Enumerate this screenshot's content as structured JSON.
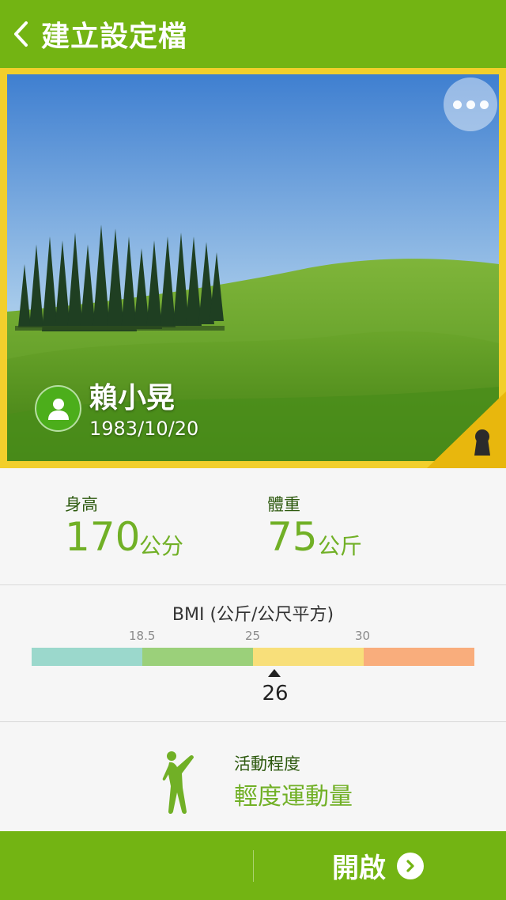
{
  "header": {
    "title": "建立設定檔"
  },
  "profile": {
    "name": "賴小晃",
    "birthdate": "1983/10/20"
  },
  "stats": {
    "height": {
      "label": "身高",
      "value": "170",
      "unit": "公分"
    },
    "weight": {
      "label": "體重",
      "value": "75",
      "unit": "公斤"
    }
  },
  "bmi": {
    "title": "BMI (公斤/公尺平方)",
    "ticks": [
      "18.5",
      "25",
      "30"
    ],
    "value": "26",
    "segment_colors": [
      "#9bd8cc",
      "#9bd07a",
      "#f8df7a",
      "#f9ad7c"
    ]
  },
  "activity": {
    "label": "活動程度",
    "value": "輕度運動量"
  },
  "footer": {
    "start_label": "開啟"
  },
  "colors": {
    "accent": "#73b413",
    "frame": "#f2cf2c",
    "value_green": "#71b026"
  }
}
